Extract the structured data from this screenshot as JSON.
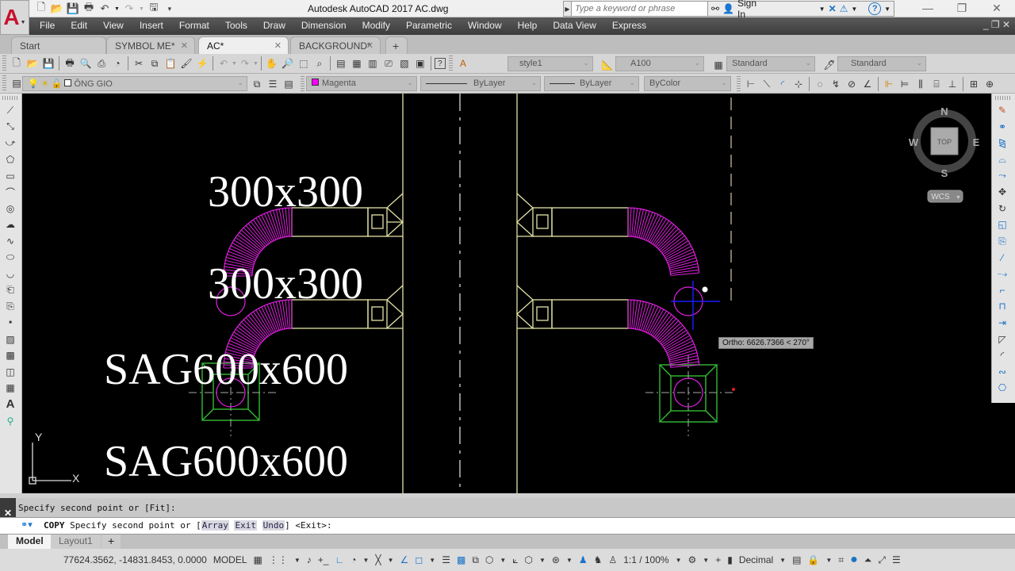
{
  "app": {
    "title": "Autodesk AutoCAD 2017    AC.dwg",
    "logo_letter": "A"
  },
  "search": {
    "placeholder": "Type a keyword or phrase"
  },
  "account": {
    "sign_in": "Sign In"
  },
  "menu": [
    "File",
    "Edit",
    "View",
    "Insert",
    "Format",
    "Tools",
    "Draw",
    "Dimension",
    "Modify",
    "Parametric",
    "Window",
    "Help",
    "Data View",
    "Express"
  ],
  "tabs": [
    {
      "label": "Start",
      "closable": false,
      "active": false
    },
    {
      "label": "SYMBOL ME*",
      "closable": true,
      "active": false
    },
    {
      "label": "AC*",
      "closable": true,
      "active": true
    },
    {
      "label": "BACKGROUND*",
      "closable": true,
      "active": false
    }
  ],
  "styles_toolbar": {
    "text_style": "style1",
    "dim_style": "A100",
    "table_style": "Standard",
    "multileader_style": "Standard"
  },
  "layers_toolbar": {
    "current_layer": "ÔNG GIO",
    "color": "Magenta",
    "color_hex": "#ff00ff",
    "linetype": "ByLayer",
    "lineweight": "ByLayer",
    "plotstyle": "ByColor"
  },
  "drawing": {
    "labels": [
      "300x300",
      "300x300",
      "SAG600x600",
      "SAG600x600"
    ],
    "tooltip": "Ortho: 6626.7366 < 270°",
    "ucs_x": "X",
    "ucs_y": "Y",
    "colors": {
      "duct": "#e3e3a6",
      "flex": "#e020e0",
      "diffuser": "#33bb33",
      "cursor": "#1a1aff"
    }
  },
  "viewcube": {
    "n": "N",
    "s": "S",
    "e": "E",
    "w": "W",
    "face": "TOP",
    "ucs": "WCS"
  },
  "command": {
    "history": "Specify second point or [Fit]:",
    "cmd_name": "COPY",
    "prompt_start": "Specify second point or [",
    "options": [
      "Array",
      "Exit",
      "Undo"
    ],
    "prompt_end": "] <Exit>:"
  },
  "layouts": [
    {
      "label": "Model",
      "active": true
    },
    {
      "label": "Layout1",
      "active": false
    }
  ],
  "status": {
    "coords": "77624.3562, -14831.8453, 0.0000",
    "space": "MODEL",
    "annoscale": "1:1 / 100%",
    "units": "Decimal"
  }
}
